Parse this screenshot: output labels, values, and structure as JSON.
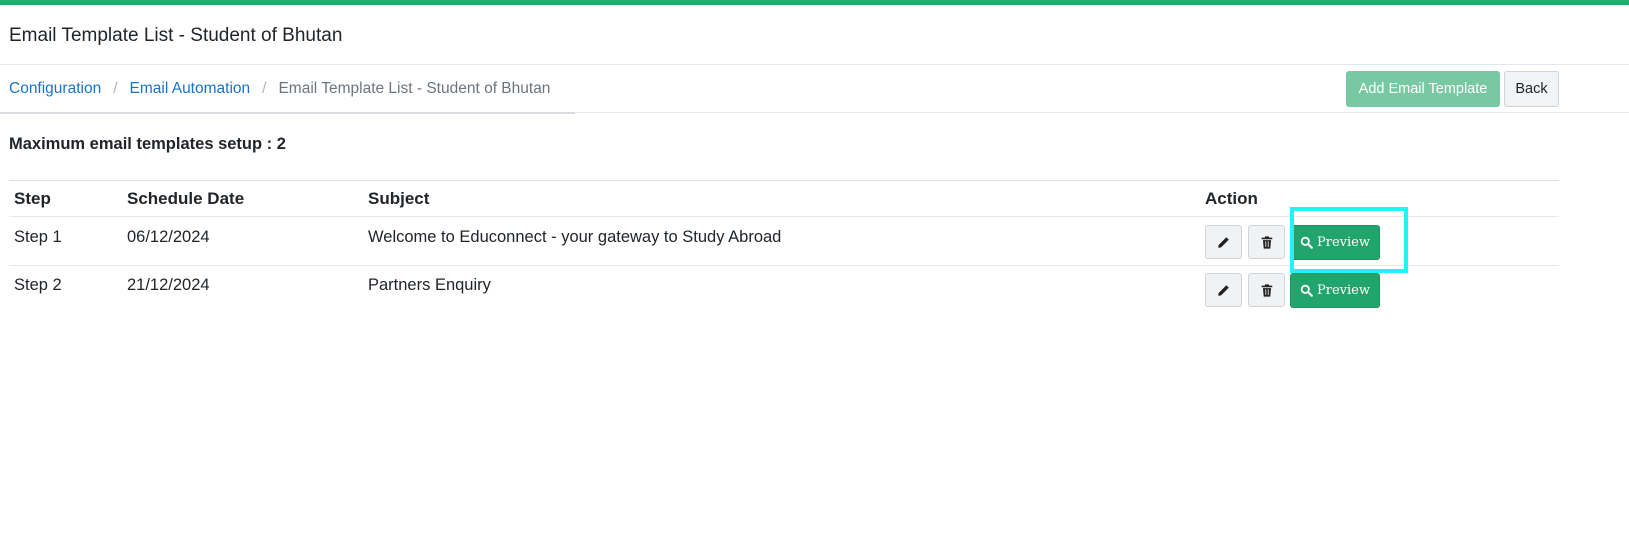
{
  "page": {
    "title": "Email Template List - Student of Bhutan"
  },
  "breadcrumb": {
    "items": [
      "Configuration",
      "Email Automation"
    ],
    "separator": "/",
    "current": "Email Template List - Student of Bhutan"
  },
  "toolbar": {
    "add_label": "Add Email Template",
    "back_label": "Back"
  },
  "summary": {
    "max_templates_label": "Maximum email templates setup : 2"
  },
  "table": {
    "headers": [
      "Step",
      "Schedule Date",
      "Subject",
      "Action"
    ],
    "rows": [
      {
        "step": "Step 1",
        "date": "06/12/2024",
        "subject": "Welcome to Educonnect - your gateway to Study Abroad",
        "preview_label": "Preview"
      },
      {
        "step": "Step 2",
        "date": "21/12/2024",
        "subject": "Partners Enquiry",
        "preview_label": "Preview"
      }
    ]
  },
  "icons": {
    "edit": "pencil-icon",
    "delete": "trash-icon",
    "preview": "search-icon"
  },
  "colors": {
    "accent": "#27a86f",
    "preview_button": "#22a56c",
    "add_button": "#78c9a3",
    "link": "#1a73c7",
    "highlight": "#20f4f7"
  }
}
